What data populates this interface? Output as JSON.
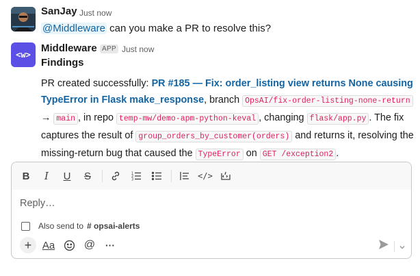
{
  "messages": [
    {
      "author": "SanJay",
      "timestamp": "Just now",
      "mention": "@Middleware",
      "text": " can you make a PR to resolve this?"
    },
    {
      "author": "Middleware",
      "badge": "APP",
      "timestamp": "Just now",
      "heading": "Findings",
      "body": {
        "intro": "PR created successfully: ",
        "pr_link": "PR #185 — Fix: order_listing view returns None causing TypeError in Flask make_response",
        "branch_text": ", branch ",
        "branch_code": "OpsAI/fix-order-listing-none-return",
        "arrow": " → ",
        "target_code": "main",
        "repo_text": ", in repo ",
        "repo_code": "temp-mw/demo-apm-python-keval",
        "changing_text": ", changing ",
        "file_code": "flask/app.py",
        "fix_text": ". The fix captures the result of ",
        "func_code": "group_orders_by_customer(orders)",
        "returns_text": " and returns it, resolving the missing-return bug that caused the ",
        "error_code": "TypeError",
        "on_text": " on ",
        "endpoint_code": "GET /exception2",
        "end_text": "."
      }
    }
  ],
  "composer": {
    "placeholder": "Reply…",
    "also_send_label": "Also send to",
    "channel": "# opsai-alerts",
    "toolbar_icons": [
      "bold-icon",
      "italic-icon",
      "underline-icon",
      "strikethrough-icon",
      "link-icon",
      "ordered-list-icon",
      "bulleted-list-icon",
      "blockquote-icon",
      "code-icon",
      "code-block-icon"
    ],
    "bottom_icons": [
      "plus-icon",
      "text-format-icon",
      "emoji-icon",
      "mention-icon",
      "more-icon"
    ]
  },
  "colors": {
    "link": "#1264a3",
    "code": "#e01e5a",
    "app_avatar": "#5b4fe6"
  }
}
